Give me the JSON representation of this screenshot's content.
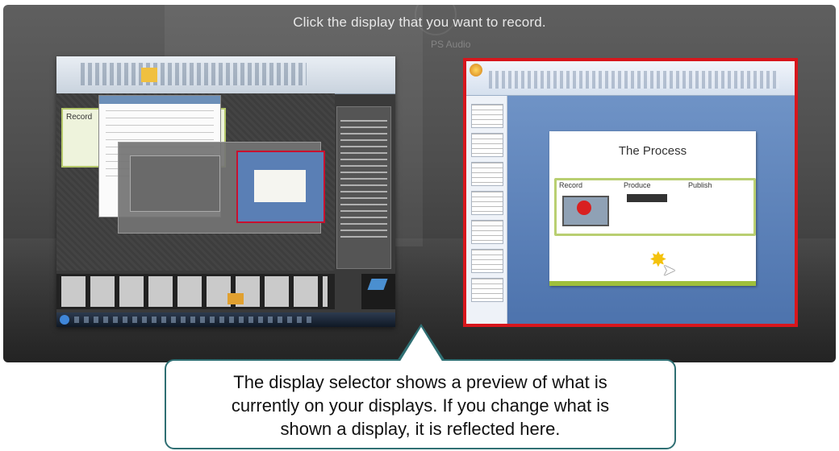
{
  "selector": {
    "instruction": "Click the display that you want to record.",
    "background_label": "PS Audio",
    "displays": [
      {
        "id": "display-1",
        "selected": false
      },
      {
        "id": "display-2",
        "selected": true
      }
    ],
    "selected_border_color": "#d7161c"
  },
  "display2_preview": {
    "slide_title": "The Process",
    "stages": [
      "Record",
      "Produce",
      "Publish"
    ]
  },
  "display1_preview": {
    "slide_stage": "Record"
  },
  "callout": {
    "text": "The display selector shows a preview of what is\ncurrently on your displays. If you change what is\nshown a display, it is reflected here.",
    "border_color": "#2f6f73"
  }
}
